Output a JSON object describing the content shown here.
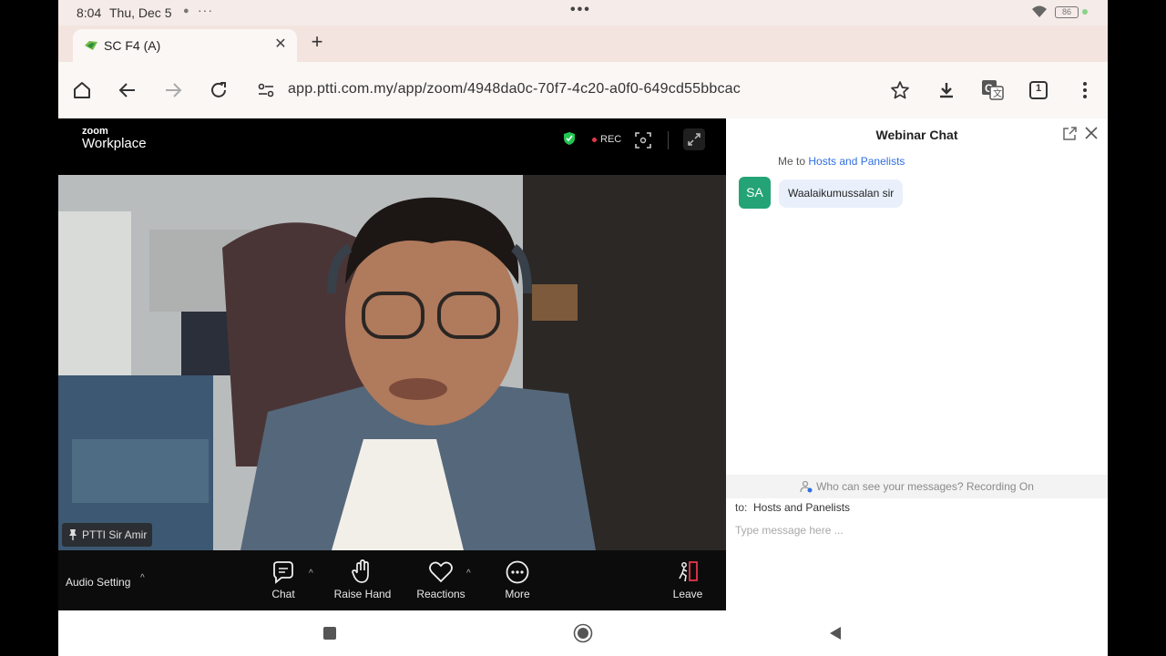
{
  "status_bar": {
    "time": "8:04",
    "date": "Thu, Dec 5",
    "battery": "86"
  },
  "browser": {
    "tab": {
      "title": "SC F4 (A)"
    },
    "url": "app.ptti.com.my/app/zoom/4948da0c-70f7-4c20-a0f0-649cd55bbcac",
    "tab_count": "1"
  },
  "zoom": {
    "logo_small": "zoom",
    "logo": "Workplace",
    "rec_label": "REC",
    "participant_name": "PTTI Sir Amir",
    "controls": {
      "audio_setting": "Audio Setting",
      "chat": "Chat",
      "raise_hand": "Raise Hand",
      "reactions": "Reactions",
      "more": "More",
      "leave": "Leave"
    }
  },
  "chat": {
    "title": "Webinar Chat",
    "message": {
      "sender": "Me",
      "to_word": "to",
      "recipient": "Hosts and Panelists",
      "avatar_initials": "SA",
      "text": "Waalaikumussalan sir"
    },
    "notice": "Who can see your messages? Recording On",
    "to_label": "to:",
    "to_value": "Hosts and Panelists",
    "input_placeholder": "Type message here ..."
  },
  "colors": {
    "accent_link": "#2f6fe0",
    "avatar_bg": "#24a377",
    "leave_red": "#e6374a"
  }
}
